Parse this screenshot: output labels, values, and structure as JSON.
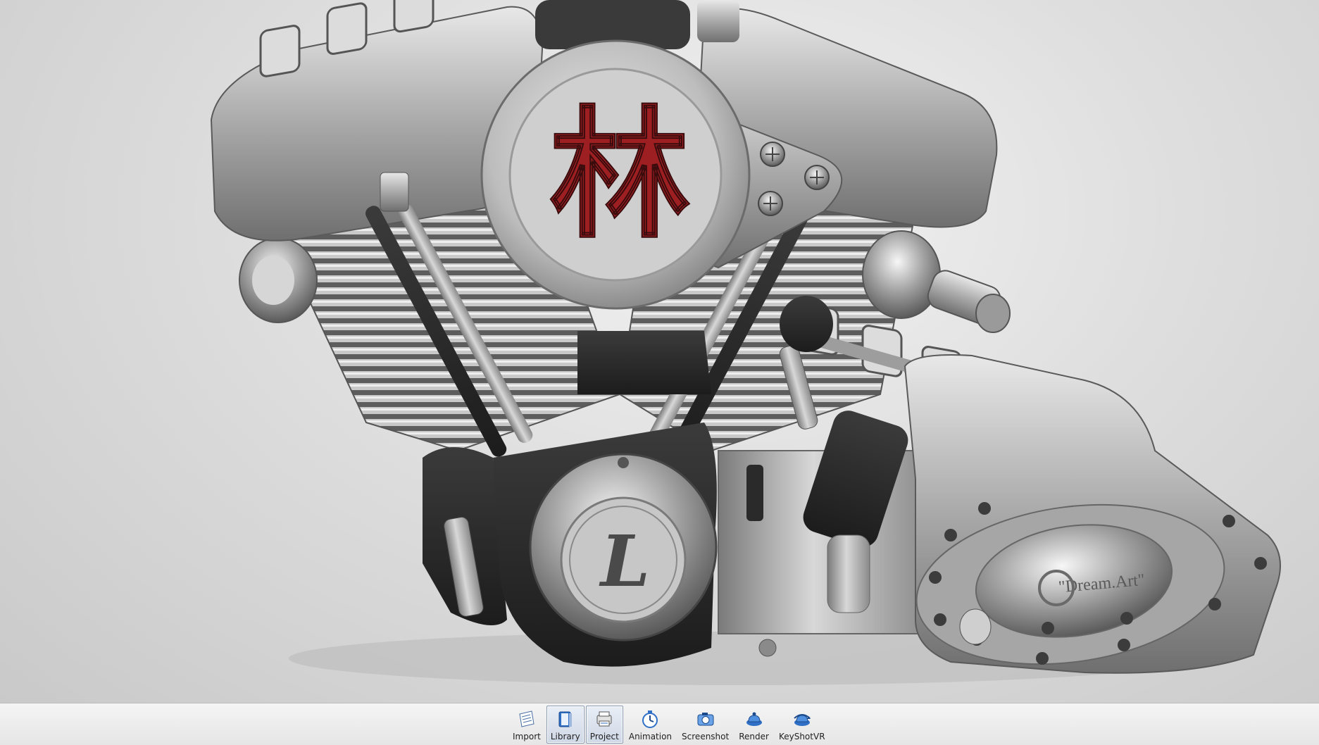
{
  "viewport": {
    "emblem_glyph": "林",
    "monogram": "L",
    "engraving": "\"Dream.Art\""
  },
  "toolbar": {
    "buttons": [
      {
        "label": "Import",
        "icon": "import-icon",
        "active": false
      },
      {
        "label": "Library",
        "icon": "library-icon",
        "active": true
      },
      {
        "label": "Project",
        "icon": "project-icon",
        "active": true
      },
      {
        "label": "Animation",
        "icon": "animation-icon",
        "active": false
      },
      {
        "label": "Screenshot",
        "icon": "screenshot-icon",
        "active": false
      },
      {
        "label": "Render",
        "icon": "render-icon",
        "active": false
      },
      {
        "label": "KeyShotVR",
        "icon": "keyshotvr-icon",
        "active": false
      }
    ]
  },
  "colors": {
    "emblem_red": "#9e1f22",
    "metal_light": "#d4d4d4",
    "metal_dark": "#4a4a4a",
    "black_part": "#262626",
    "icon_blue": "#2f6fc6"
  }
}
